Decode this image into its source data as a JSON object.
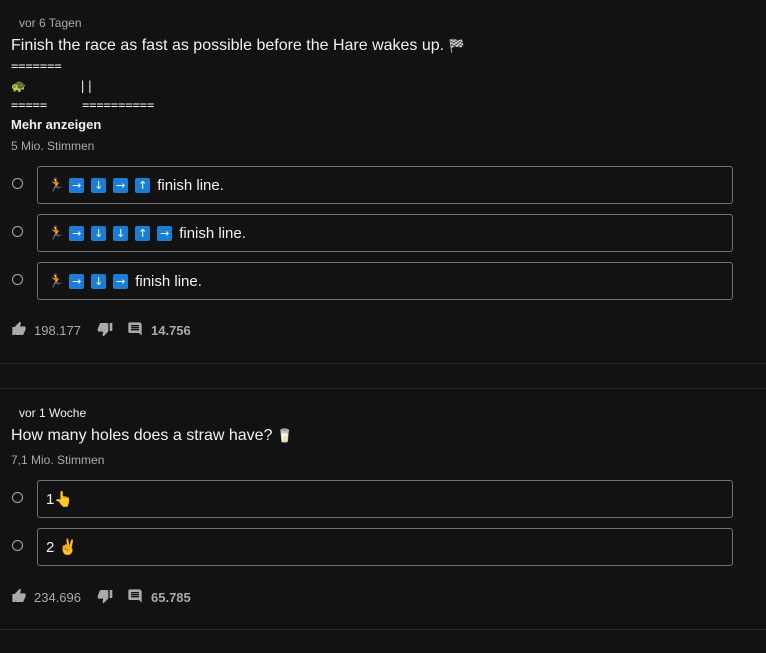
{
  "posts": [
    {
      "time": "vor 6 Tagen",
      "title": "Finish the race as fast as possible before the Hare wakes up.",
      "title_emoji": "🏁",
      "race_lines": [
        "=======",
        "🐢",
        "||",
        "=====",
        "=========="
      ],
      "more_label": "Mehr anzeigen",
      "votes": "5 Mio. Stimmen",
      "options": [
        {
          "runner": "🏃",
          "arrows": [
            "→",
            "↓",
            "→",
            "↑"
          ],
          "text": "finish line."
        },
        {
          "runner": "🏃",
          "arrows": [
            "→",
            "↓",
            "↓",
            "↑",
            "→"
          ],
          "text": "finish line."
        },
        {
          "runner": "🏃",
          "arrows": [
            "→",
            "↓",
            "→"
          ],
          "text": "finish line."
        }
      ],
      "likes": "198.177",
      "comments": "14.756"
    },
    {
      "time": "vor 1 Woche",
      "title": "How many holes does a straw have?",
      "title_emoji": "🥛",
      "votes": "7,1 Mio. Stimmen",
      "options": [
        {
          "text": "1👆"
        },
        {
          "text": "2 ✌"
        }
      ],
      "likes": "234.696",
      "comments": "65.785"
    }
  ],
  "icons": {
    "like": "thumb-up-icon",
    "dislike": "thumb-down-icon",
    "comment": "comment-icon",
    "radio": "radio-button"
  },
  "colors": {
    "background": "#121212",
    "text": "#f1f1f1",
    "secondary": "#aaaaaa",
    "arrow_box": "#1a7fd4"
  }
}
